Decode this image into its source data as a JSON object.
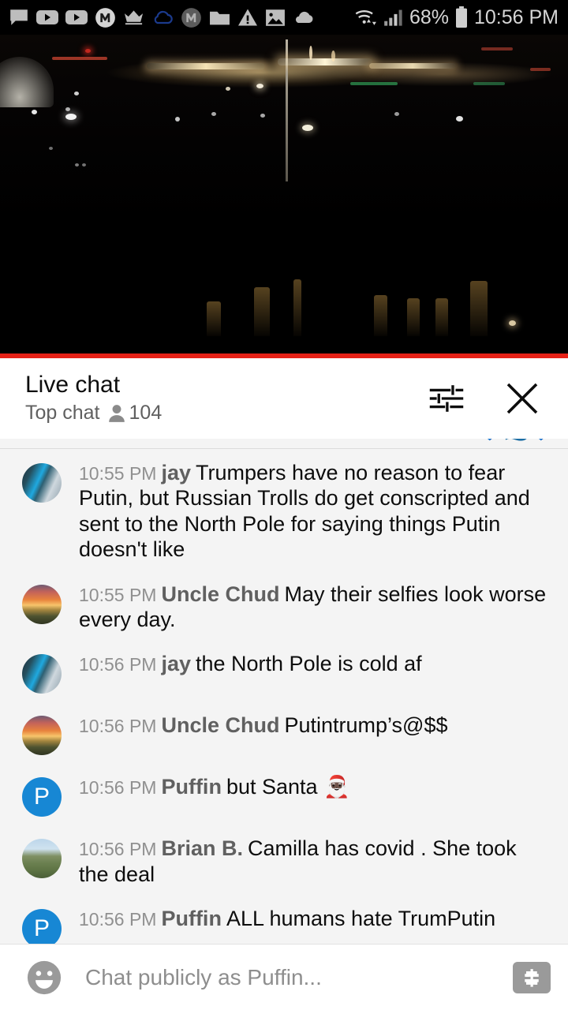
{
  "status_bar": {
    "time": "10:56 PM",
    "battery_percent": "68%",
    "icons": [
      "chat-bubble-icon",
      "youtube-icon",
      "youtube-icon",
      "m-circle-icon",
      "crown-icon",
      "cloud-outline-icon",
      "m-circle-gray-icon",
      "folder-icon",
      "warning-triangle-icon",
      "image-icon",
      "cloud-filled-icon",
      "wifi-icon",
      "cellular-signal-icon",
      "battery-icon"
    ]
  },
  "video": {
    "name": "live-night-cityscape-stream",
    "progress_percent": 100,
    "progress_color": "#e62117"
  },
  "chat_header": {
    "title": "Live chat",
    "mode": "Top chat",
    "viewer_count": "104",
    "settings_icon": "tune-sliders-icon",
    "close_icon": "close-x-icon"
  },
  "clipped_message": {
    "text": " ",
    "emoji": "💙🌊💙"
  },
  "messages": [
    {
      "time": "10:55 PM",
      "author": "jay",
      "text": "Trumpers have no reason to fear Putin, but Russian Trolls do get conscripted and sent to the North Pole for saying things Putin doesn't like",
      "avatar_type": "city",
      "avatar_letter": ""
    },
    {
      "time": "10:55 PM",
      "author": "Uncle Chud",
      "text": "May their selfies look worse every day.",
      "avatar_type": "sunset",
      "avatar_letter": ""
    },
    {
      "time": "10:56 PM",
      "author": "jay",
      "text": "the North Pole is cold af",
      "avatar_type": "city",
      "avatar_letter": ""
    },
    {
      "time": "10:56 PM",
      "author": "Uncle Chud",
      "text": "Putintrump’s@$$",
      "avatar_type": "sunset",
      "avatar_letter": ""
    },
    {
      "time": "10:56 PM",
      "author": "Puffin",
      "text": "but Santa 🎅🏿",
      "avatar_type": "letter",
      "avatar_letter": "P"
    },
    {
      "time": "10:56 PM",
      "author": "Brian B.",
      "text": "Camilla has covid . She took the deal",
      "avatar_type": "field",
      "avatar_letter": ""
    },
    {
      "time": "10:56 PM",
      "author": "Puffin",
      "text": "ALL humans hate TrumPutin",
      "avatar_type": "letter",
      "avatar_letter": "P"
    }
  ],
  "input_bar": {
    "placeholder": "Chat publicly as Puffin...",
    "emoji_icon": "smiley-face-icon",
    "superchat_icon": "dollar-sign-icon"
  },
  "colors": {
    "accent_red": "#e62117",
    "avatar_blue": "#1787d4",
    "chat_bg": "#f4f4f4",
    "author_gray": "#606060",
    "time_gray": "#909090"
  }
}
